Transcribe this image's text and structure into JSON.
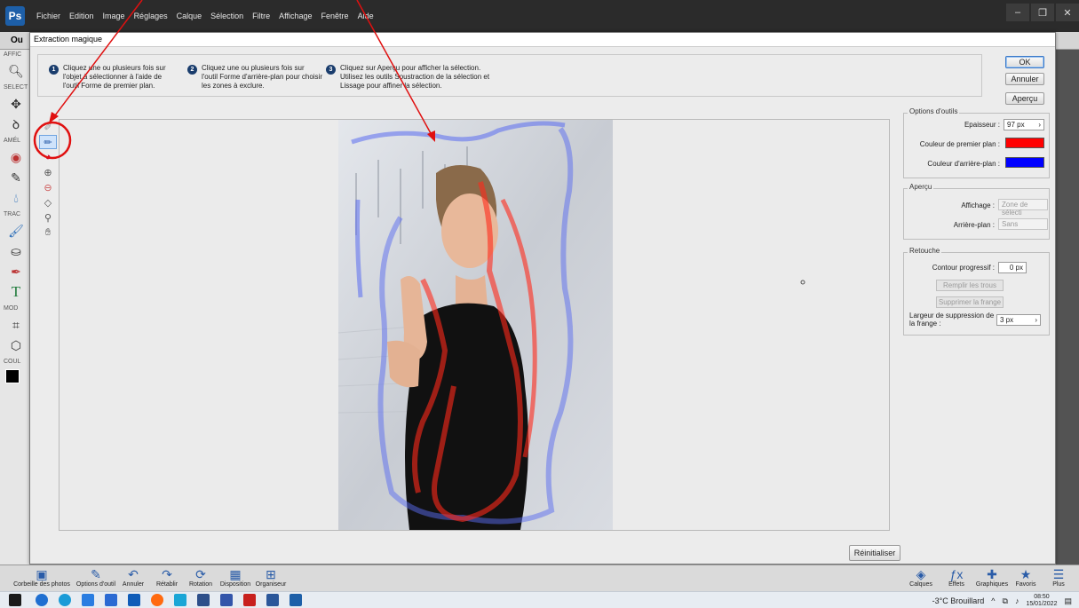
{
  "menubar": {
    "items": [
      "Fichier",
      "Edition",
      "Image",
      "Réglages",
      "Calque",
      "Sélection",
      "Filtre",
      "Affichage",
      "Fenêtre",
      "Aide"
    ],
    "window_controls": [
      "–",
      "❐",
      "✕"
    ]
  },
  "doc_tab": {
    "title": "Ou"
  },
  "left_toolbar": {
    "sections": [
      "AFFIC",
      "SELECT",
      "AMÉL",
      "TRAC",
      "MOD",
      "COUL"
    ]
  },
  "dialog": {
    "title": "Extraction magique",
    "steps": [
      {
        "num": "1",
        "text_lines": [
          "Cliquez une ou plusieurs fois sur",
          "l'objet à sélectionner à l'aide de",
          "l'outil Forme de premier plan."
        ]
      },
      {
        "num": "2",
        "text_lines": [
          "Cliquez une ou plusieurs fois sur",
          "l'outil Forme d'arrière-plan pour choisir",
          "les zones à exclure."
        ]
      },
      {
        "num": "3",
        "text_lines": [
          "Cliquez sur Aperçu pour afficher la sélection.",
          "Utilisez les outils Soustraction de la sélection et",
          "Lissage pour affiner la sélection."
        ]
      }
    ],
    "buttons": {
      "ok": "OK",
      "cancel": "Annuler",
      "preview": "Aperçu",
      "reset": "Réinitialiser"
    },
    "tool_options": {
      "title": "Options d'outils",
      "thickness_label": "Epaisseur :",
      "thickness_value": "97 px",
      "fg_label": "Couleur de premier plan :",
      "fg_color": "#ff0000",
      "bg_label": "Couleur d'arrière-plan :",
      "bg_color": "#0000ff"
    },
    "preview": {
      "title": "Aperçu",
      "display_label": "Affichage :",
      "display_value": "Zone de sélecti",
      "background_label": "Arrière-plan :",
      "background_value": "Sans"
    },
    "retouch": {
      "title": "Retouche",
      "feather_label": "Contour progressif :",
      "feather_value": "0 px",
      "fill_holes": "Remplir les trous",
      "remove_fringe": "Supprimer la frange",
      "fringe_width_label_1": "Largeur de suppression de",
      "fringe_width_label_2": "la frange :",
      "fringe_width_value": "3 px"
    }
  },
  "bottom_toolbar": {
    "items": [
      "Corbeille des photos",
      "Options d'outil",
      "Annuler",
      "Rétablir",
      "Rotation",
      "Disposition",
      "Organiseur"
    ],
    "right_items": [
      "Calques",
      "Effets",
      "Graphiques",
      "Favoris",
      "Plus"
    ]
  },
  "taskbar": {
    "weather": "-3°C  Brouillard",
    "time": "08:50",
    "date": "15/01/2022"
  },
  "colors": {
    "annotation": "#e01010",
    "fg_stroke": "#ff2a1a",
    "bg_stroke": "#5a6cf0"
  }
}
